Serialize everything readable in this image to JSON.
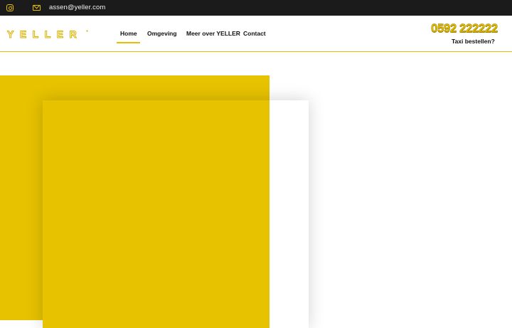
{
  "topbar": {
    "instagram_icon": "instagram-icon",
    "mail_icon": "mail-icon",
    "email": "assen@yeller.com"
  },
  "header": {
    "logo_text": "YELLER",
    "nav": [
      {
        "label": "Home",
        "active": true
      },
      {
        "label": "Omgeving"
      },
      {
        "label": "Meer over YELLER"
      },
      {
        "label": "Contact"
      }
    ],
    "phone": "0592 222222",
    "order_label": "Taxi bestellen?"
  },
  "colors": {
    "accent": "#e6c200",
    "topbar_bg": "#1b1b1b",
    "text": "#111111"
  }
}
